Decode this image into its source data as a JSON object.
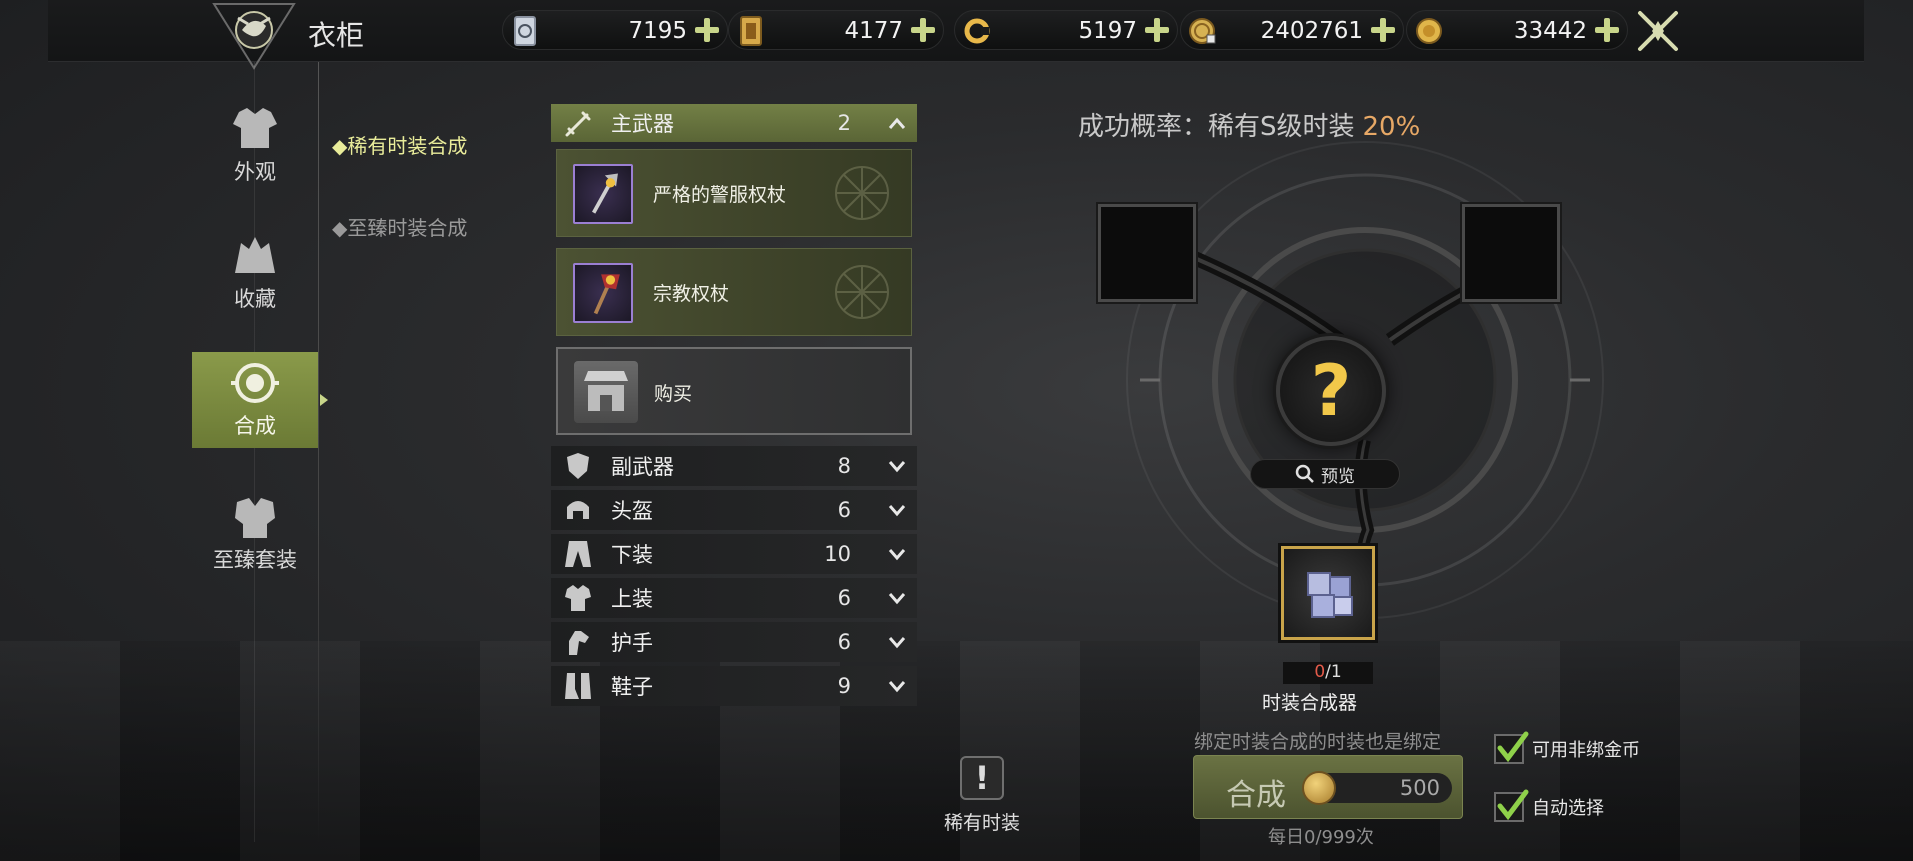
{
  "header": {
    "title": "衣柜",
    "currencies": [
      {
        "icon": "ticket-card-icon",
        "value": "7195"
      },
      {
        "icon": "gold-card-icon",
        "value": "4177"
      },
      {
        "icon": "swirl-token-icon",
        "value": "5197"
      },
      {
        "icon": "bound-gold-coin-icon",
        "value": "2402761"
      },
      {
        "icon": "gold-coin-icon",
        "value": "33442"
      }
    ]
  },
  "nav": {
    "items": [
      {
        "label": "外观",
        "icon": "armor-icon"
      },
      {
        "label": "收藏",
        "icon": "collection-icon"
      },
      {
        "label": "合成",
        "icon": "synthesis-icon",
        "active": true
      },
      {
        "label": "至臻套装",
        "icon": "set-icon"
      }
    ]
  },
  "subnav": {
    "items": [
      {
        "label": "稀有时装合成",
        "active": true
      },
      {
        "label": "至臻时装合成",
        "active": false
      }
    ]
  },
  "categories": {
    "expanded": {
      "label": "主武器",
      "count": "2"
    },
    "sub_items": [
      {
        "name": "严格的警服权杖"
      },
      {
        "name": "宗教权杖"
      }
    ],
    "buy_label": "购买",
    "collapsed": [
      {
        "label": "副武器",
        "count": "8"
      },
      {
        "label": "头盔",
        "count": "6"
      },
      {
        "label": "下装",
        "count": "10"
      },
      {
        "label": "上装",
        "count": "6"
      },
      {
        "label": "护手",
        "count": "6"
      },
      {
        "label": "鞋子",
        "count": "9"
      }
    ]
  },
  "synthesis": {
    "rate_label": "成功概率：稀有S级时装",
    "rate_value": "20%",
    "result_symbol": "?",
    "preview_label": "预览",
    "material_count_have": "0",
    "material_count_need": "/1",
    "material_name": "时装合成器",
    "note": "绑定时装合成的时装也是绑定",
    "button_label": "合成",
    "cost": "500",
    "daily": "每日0/999次",
    "options": [
      {
        "label": "可用非绑金币",
        "checked": true
      },
      {
        "label": "自动选择",
        "checked": true
      }
    ],
    "rare_label": "稀有时装",
    "rare_symbol": "!"
  },
  "colors": {
    "accent": "#6b7a35",
    "highlight_text": "#e9ec9a",
    "rate_value": "#e7a866",
    "question_mark": "#f2c84a",
    "check": "#8fd14a"
  }
}
